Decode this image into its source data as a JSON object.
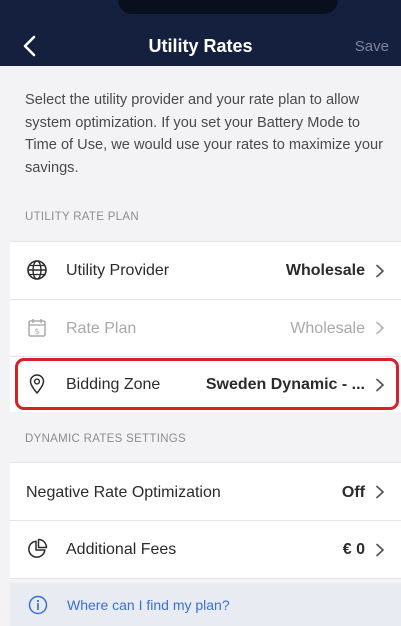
{
  "header": {
    "title": "Utility Rates",
    "save_label": "Save"
  },
  "intro_text": "Select the utility provider and your rate plan to allow system optimization. If you set your Battery Mode to Time of Use, we would use your rates to maximize your savings.",
  "utility_rate_plan": {
    "section_label": "UTILITY RATE PLAN",
    "rows": [
      {
        "label": "Utility Provider",
        "value": "Wholesale",
        "icon": "globe-icon"
      },
      {
        "label": "Rate Plan",
        "value": "Wholesale",
        "icon": "calendar-dollar-icon"
      },
      {
        "label": "Bidding Zone",
        "value": "Sweden Dynamic - ...",
        "icon": "location-pin-icon"
      }
    ]
  },
  "dynamic_rates": {
    "section_label": "DYNAMIC RATES SETTINGS",
    "rows": [
      {
        "label": "Negative Rate Optimization",
        "value": "Off"
      },
      {
        "label": "Additional Fees",
        "value": "€ 0",
        "icon": "pie-chart-icon"
      }
    ]
  },
  "help": {
    "link_text": "Where can I find my plan?",
    "icon": "info-circle-icon"
  },
  "colors": {
    "header_bg": "#15203f",
    "highlight_border": "#d6202a",
    "link": "#3a6fd8"
  }
}
